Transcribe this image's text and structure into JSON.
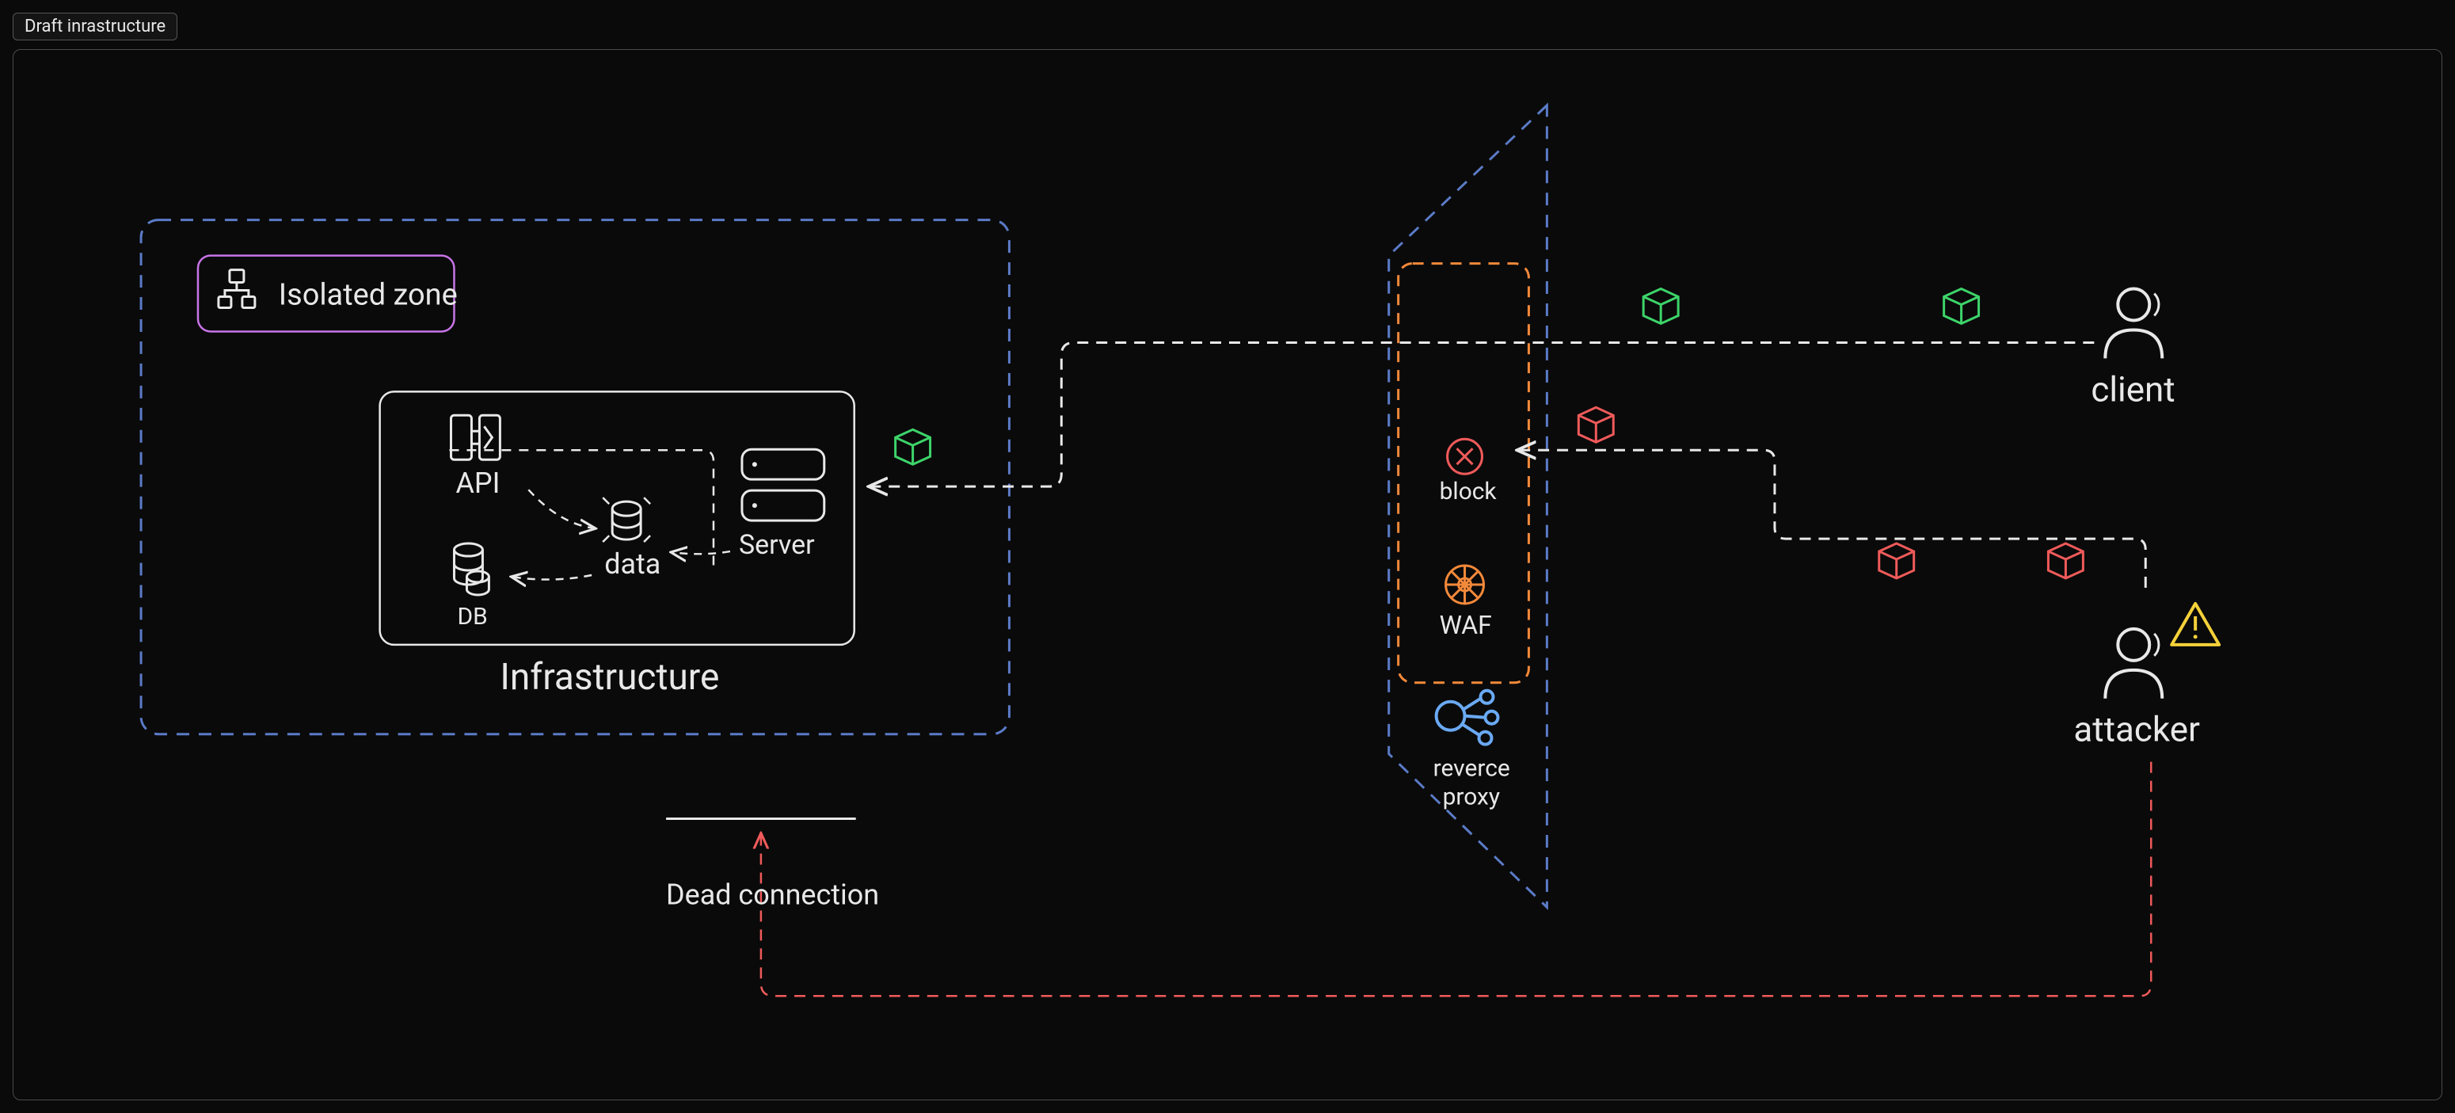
{
  "tab": {
    "title": "Draft inrastructure"
  },
  "diagram": {
    "isolated_zone": {
      "label": "Isolated zone"
    },
    "infrastructure": {
      "title": "Infrastructure",
      "nodes": {
        "api": "API",
        "db": "DB",
        "data": "data",
        "server": "Server"
      }
    },
    "proxy_plane": {
      "block": "block",
      "waf": "WAF",
      "reverse_proxy_line1": "reverce",
      "reverse_proxy_line2": "proxy"
    },
    "actors": {
      "client": "client",
      "attacker": "attacker"
    },
    "dead_connection": "Dead connection"
  },
  "colors": {
    "blue_dash": "#5b7bc7",
    "violet": "#c874e8",
    "orange": "#f4893a",
    "green": "#3dd46a",
    "red": "#f05a5a",
    "yellow": "#f4d13a",
    "cyan": "#6aa9f4",
    "white": "#e8e8e8"
  }
}
